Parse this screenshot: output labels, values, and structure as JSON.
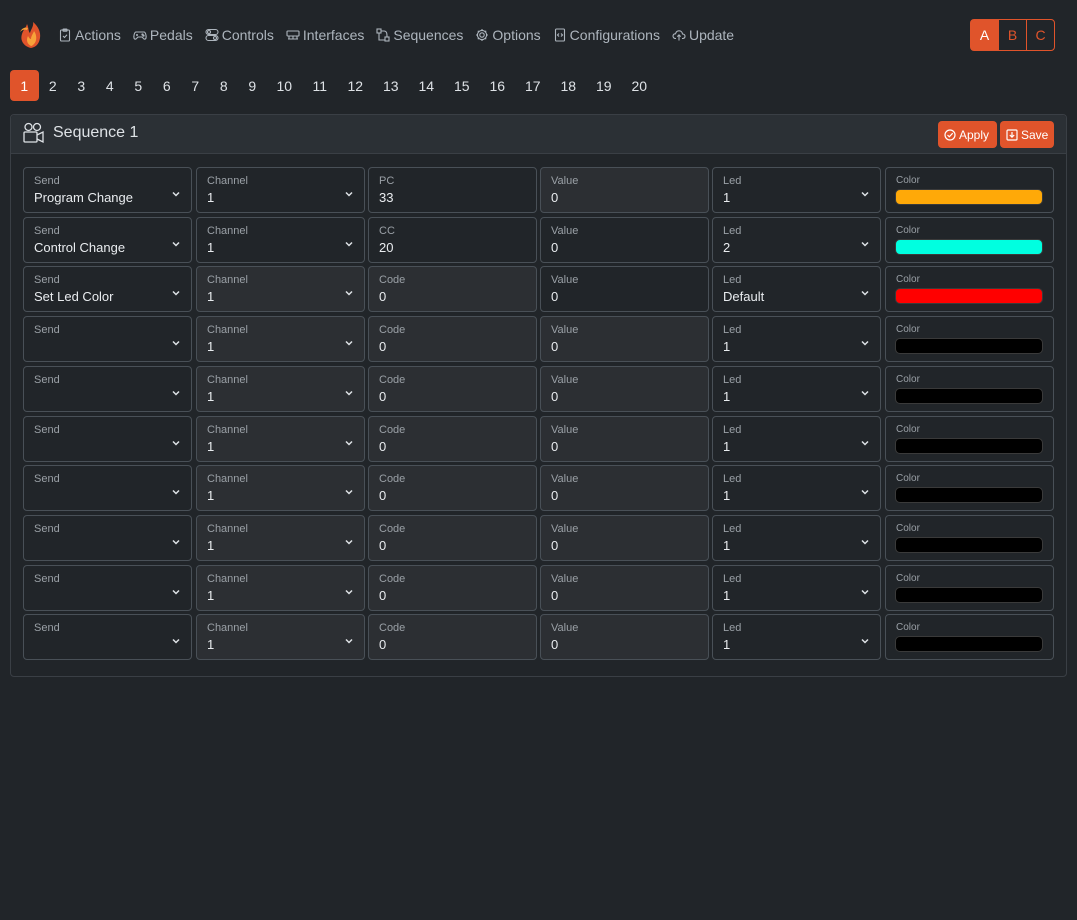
{
  "nav": {
    "items": [
      {
        "label": "Actions",
        "icon": "clipboard-icon"
      },
      {
        "label": "Pedals",
        "icon": "gamepad-icon"
      },
      {
        "label": "Controls",
        "icon": "toggles-icon"
      },
      {
        "label": "Interfaces",
        "icon": "ethernet-icon"
      },
      {
        "label": "Sequences",
        "icon": "bezier-icon"
      },
      {
        "label": "Options",
        "icon": "gear-icon"
      },
      {
        "label": "Configurations",
        "icon": "code-file-icon"
      },
      {
        "label": "Update",
        "icon": "cloud-upload-icon"
      }
    ],
    "banks": [
      "A",
      "B",
      "C"
    ],
    "active_bank": "A"
  },
  "pager": {
    "pages": [
      "1",
      "2",
      "3",
      "4",
      "5",
      "6",
      "7",
      "8",
      "9",
      "10",
      "11",
      "12",
      "13",
      "14",
      "15",
      "16",
      "17",
      "18",
      "19",
      "20"
    ],
    "active": "1"
  },
  "card": {
    "title": "Sequence 1",
    "apply_label": "Apply",
    "save_label": "Save"
  },
  "columns": {
    "send": "Send",
    "channel": "Channel",
    "value": "Value",
    "led": "Led",
    "color": "Color"
  },
  "rows": [
    {
      "send": "Program Change",
      "channel": "1",
      "code_label": "PC",
      "code": "33",
      "value": "0",
      "led": "1",
      "color": "#ffa908",
      "channel_disabled": false,
      "code_disabled": false,
      "value_disabled": true
    },
    {
      "send": "Control Change",
      "channel": "1",
      "code_label": "CC",
      "code": "20",
      "value": "0",
      "led": "2",
      "color": "#00ffe0",
      "channel_disabled": false,
      "code_disabled": false,
      "value_disabled": false
    },
    {
      "send": "Set Led Color",
      "channel": "1",
      "code_label": "Code",
      "code": "0",
      "value": "0",
      "led": "Default",
      "color": "#ff0000",
      "channel_disabled": true,
      "code_disabled": true,
      "value_disabled": false
    },
    {
      "send": "",
      "channel": "1",
      "code_label": "Code",
      "code": "0",
      "value": "0",
      "led": "1",
      "color": "#000000",
      "channel_disabled": true,
      "code_disabled": true,
      "value_disabled": true
    },
    {
      "send": "",
      "channel": "1",
      "code_label": "Code",
      "code": "0",
      "value": "0",
      "led": "1",
      "color": "#000000",
      "channel_disabled": true,
      "code_disabled": true,
      "value_disabled": true
    },
    {
      "send": "",
      "channel": "1",
      "code_label": "Code",
      "code": "0",
      "value": "0",
      "led": "1",
      "color": "#000000",
      "channel_disabled": true,
      "code_disabled": true,
      "value_disabled": true
    },
    {
      "send": "",
      "channel": "1",
      "code_label": "Code",
      "code": "0",
      "value": "0",
      "led": "1",
      "color": "#000000",
      "channel_disabled": true,
      "code_disabled": true,
      "value_disabled": true
    },
    {
      "send": "",
      "channel": "1",
      "code_label": "Code",
      "code": "0",
      "value": "0",
      "led": "1",
      "color": "#000000",
      "channel_disabled": true,
      "code_disabled": true,
      "value_disabled": true
    },
    {
      "send": "",
      "channel": "1",
      "code_label": "Code",
      "code": "0",
      "value": "0",
      "led": "1",
      "color": "#000000",
      "channel_disabled": true,
      "code_disabled": true,
      "value_disabled": true
    },
    {
      "send": "",
      "channel": "1",
      "code_label": "Code",
      "code": "0",
      "value": "0",
      "led": "1",
      "color": "#000000",
      "channel_disabled": true,
      "code_disabled": true,
      "value_disabled": true
    }
  ],
  "theme": {
    "accent": "#e0542b"
  }
}
